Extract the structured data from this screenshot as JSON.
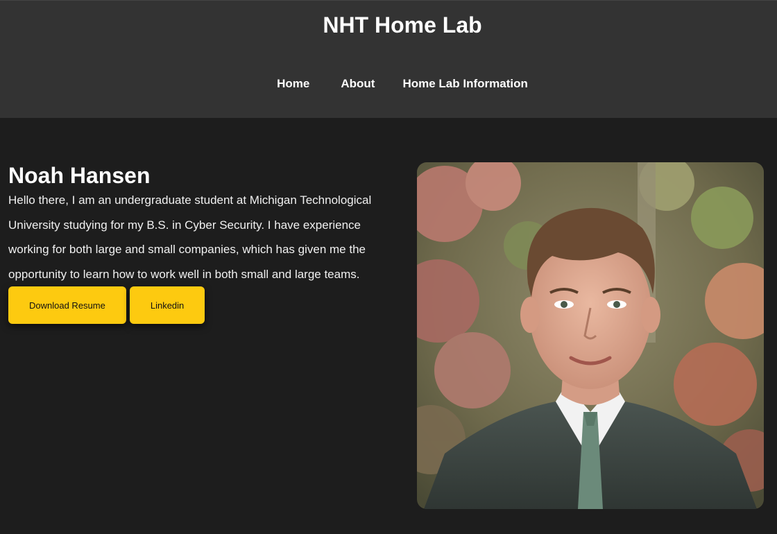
{
  "header": {
    "site_title": "NHT Home Lab",
    "nav": [
      {
        "label": "Home"
      },
      {
        "label": "About"
      },
      {
        "label": "Home Lab Information"
      }
    ]
  },
  "hero": {
    "name": "Noah Hansen",
    "bio": "Hello there, I am an undergraduate student at Michigan Technological University studying for my B.S. in Cyber Security. I have experience working for both large and small companies, which has given me the opportunity to learn how to work well in both small and large teams.",
    "buttons": {
      "resume_label": "Download Resume",
      "linkedin_label": "Linkedin"
    },
    "accent_color": "#fdca10"
  }
}
